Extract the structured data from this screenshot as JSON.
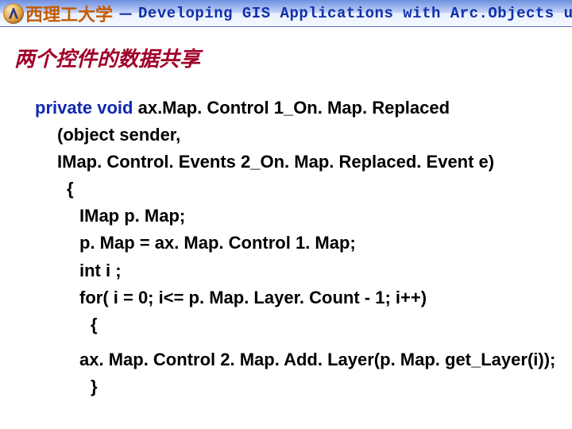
{
  "header": {
    "cn": "西理工大学",
    "dash": "－",
    "en": "Developing GIS Applications with Arc.Objects using C#. NE"
  },
  "title": "两个控件的数据共享",
  "code": {
    "l1a": "private void",
    "l1b": " ax.Map. Control 1_On. Map. Replaced",
    "l2a": "(object sender,",
    "l3a": "IMap. Control. Events 2_On. Map. Replaced. Event e)",
    "l4a": "{",
    "l5a": "IMap p. Map;",
    "l6a": "p. Map = ax. Map. Control 1. Map;",
    "l7a": "int i ;",
    "l8a": "for( i = 0; i<= p. Map. Layer. Count - 1; i++)",
    "l9a": "{",
    "l10a": "ax. Map. Control 2. Map. Add. Layer(p. Map. get_Layer(i));",
    "l11a": "}"
  }
}
